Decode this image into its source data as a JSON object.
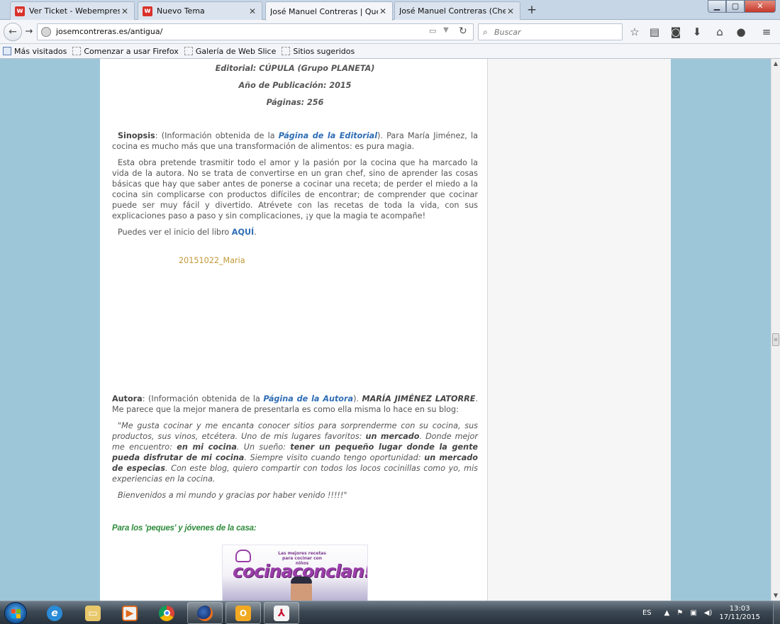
{
  "browser": {
    "tabs": [
      {
        "title": "Ver Ticket - Webempresa E...",
        "favicon": "w"
      },
      {
        "title": "Nuevo Tema",
        "favicon": "w"
      },
      {
        "title": "José Manuel Contreras | Que n...",
        "active": true
      },
      {
        "title": "José Manuel Contreras (Chema..."
      }
    ],
    "url": "josemcontreras.es/antigua/",
    "search_placeholder": "Buscar",
    "bookmarks": [
      "Más visitados",
      "Comenzar a usar Firefox",
      "Galería de Web Slice",
      "Sitios sugeridos"
    ]
  },
  "article": {
    "editorial": "Editorial: CÚPULA (Grupo PLANETA)",
    "year": "Año de Publicación: 2015",
    "pages": "Páginas: 256",
    "sinopsis_label": "Sinopsis",
    "sinopsis_text1": ": (Información obtenida de la ",
    "sinopsis_link": "Página de la Editorial",
    "sinopsis_text2": "). Para María Jiménez, la cocina es mucho más que una transformación de alimentos: es pura magia.",
    "body_paragraph": "Esta obra pretende trasmitir todo el amor y la pasión por la cocina que ha marcado la vida de la autora. No se trata de convertirse en un gran chef, sino de aprender las cosas básicas que hay que saber antes de ponerse a cocinar una receta; de perder el miedo a la cocina sin complicarse con productos difíciles de encontrar; de comprender que cocinar puede ser muy fácil y divertido. Atrévete con las recetas de toda la vida, con sus explicaciones paso a paso y sin complicaciones, ¡y que la magia te acompañe!",
    "preview_text": "Puedes ver el inicio del libro ",
    "preview_link": "AQUÍ",
    "image_caption": "20151022_Maria",
    "autora_label": "Autora",
    "autora_text1": ": (Información obtenida de la ",
    "autora_link": "Página de la Autora",
    "autora_text2": "). ",
    "autora_name": "MARÍA JIMÉNEZ LATORRE",
    "autora_text3": ". Me parece que la mejor manera de presentarla es como ella misma lo hace en su blog:",
    "quote_1": "\"Me gusta cocinar y me encanta conocer sitios para sorprenderme con su cocina, sus productos, sus vinos, etcétera. Uno de mis lugares favoritos: ",
    "quote_b1": "un mercado",
    "quote_2": ". Donde mejor me encuentro: ",
    "quote_b2": "en mi cocina",
    "quote_3": ". Un sueño: ",
    "quote_b3": "tener un pequeño lugar donde la gente pueda disfrutar de mi cocina",
    "quote_4": ". Siempre visito cuando tengo oportunidad: ",
    "quote_b4": "un mercado de especias",
    "quote_5": ". Con este blog, quiero compartir con todos los locos cocinillas como yo, mis experiencias en la cocina.",
    "quote_closing": "Bienvenidos a mi mundo y gracias por haber venido !!!!!\"",
    "kids_heading": "Para los 'peques' y jóvenes de la casa:",
    "cover_subtitle": "Las mejores recetas para cocinar con niños",
    "cover_title": "cocinaconclan!"
  },
  "taskbar": {
    "language": "ES",
    "time": "13:03",
    "date": "17/11/2015"
  },
  "colors": {
    "page_background": "#9ec6d9",
    "link_blue": "#2f6db5",
    "caption_gold": "#c09836",
    "kids_green": "#2e8b3b",
    "cover_purple": "#9a3ea9"
  }
}
